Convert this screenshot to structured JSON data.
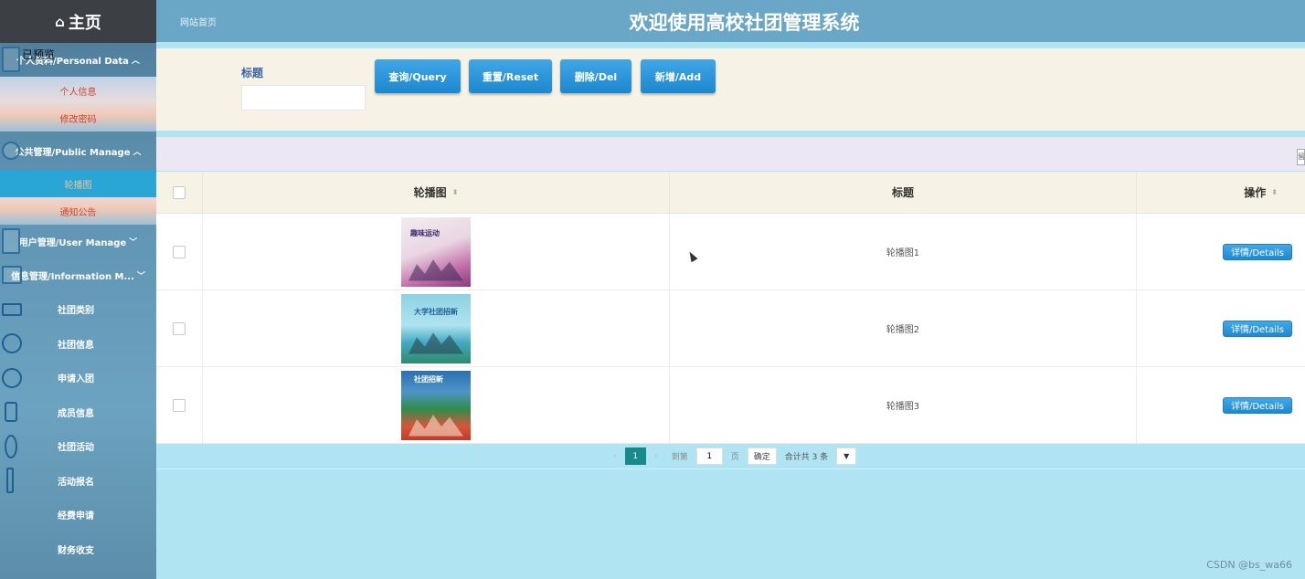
{
  "sidebar": {
    "home_icon": "house-icon",
    "home_label": "主页",
    "overlay_label": "已预览",
    "sections": [
      {
        "label": "个人资料/Personal Data",
        "icon": "person-icon",
        "expanded": true,
        "items": [
          {
            "label": "个人信息"
          },
          {
            "label": "修改密码"
          }
        ]
      },
      {
        "label": "公共管理/Public Manage",
        "icon": "people-icon",
        "expanded": true,
        "items": [
          {
            "label": "轮播图",
            "active": true
          },
          {
            "label": "通知公告"
          }
        ]
      },
      {
        "label": "用户管理/User Manage",
        "icon": "user-icon",
        "expanded": false
      },
      {
        "label": "信息管理/Information M...",
        "icon": "info-icon",
        "expanded": true,
        "items": [
          {
            "label": "社团类别"
          },
          {
            "label": "社团信息"
          },
          {
            "label": "申请入团"
          },
          {
            "label": "成员信息"
          },
          {
            "label": "社团活动"
          },
          {
            "label": "活动报名"
          },
          {
            "label": "经费申请"
          },
          {
            "label": "财务收支"
          }
        ]
      }
    ]
  },
  "header": {
    "breadcrumb": "网站首页",
    "title": "欢迎使用高校社团管理系统"
  },
  "search": {
    "label": "标题",
    "value": "",
    "placeholder": "",
    "buttons": [
      {
        "label": "查询/Query"
      },
      {
        "label": "重置/Reset"
      },
      {
        "label": "删除/Del"
      },
      {
        "label": "新增/Add"
      }
    ]
  },
  "toolbar": {
    "mini_label": "留"
  },
  "table": {
    "columns": [
      {
        "label": "轮播图",
        "sortable": true
      },
      {
        "label": "标题",
        "sortable": false
      },
      {
        "label": "操作",
        "sortable": true
      }
    ],
    "rows": [
      {
        "image_caption": "趣味运动",
        "title": "轮播图1",
        "action": "详情/Details"
      },
      {
        "image_caption": "大学社团招新",
        "title": "轮播图2",
        "action": "详情/Details"
      },
      {
        "image_caption": "社团招新",
        "title": "轮播图3",
        "action": "详情/Details"
      }
    ]
  },
  "pagination": {
    "prev": "‹",
    "current_page": "1",
    "next": "›",
    "goto_label": "到第",
    "goto_value": "1",
    "page_unit": "页",
    "confirm_label": "确定",
    "total_label": "合计共 3 条",
    "size_select_icon": "chevron-down-icon"
  },
  "watermark": "CSDN @bs_wa66",
  "colors": {
    "header_bg": "#6aa6c6",
    "button_blue": "#1d88cf",
    "active_menu": "#29a6d6",
    "pager_active": "#188a8c",
    "page_bg": "#b1e4f3",
    "search_bg": "#f6f2e5"
  }
}
